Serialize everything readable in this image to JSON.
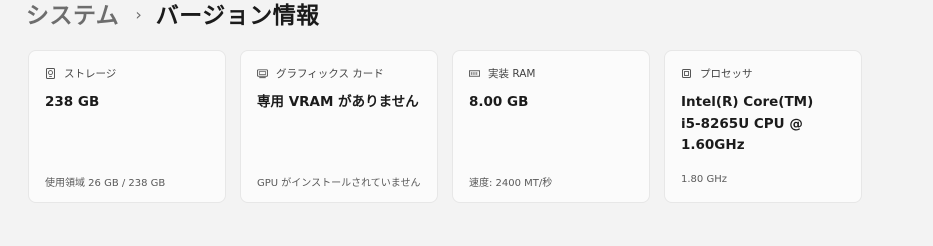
{
  "breadcrumb": {
    "parent": "システム",
    "separator": "›",
    "current": "バージョン情報"
  },
  "cards": [
    {
      "icon": "storage-icon",
      "title": "ストレージ",
      "value": "238 GB",
      "sub": "使用領域 26 GB / 238 GB"
    },
    {
      "icon": "graphics-card-icon",
      "title": "グラフィックス カード",
      "value": "専用 VRAM がありません",
      "sub": "GPU がインストールされていません"
    },
    {
      "icon": "memory-icon",
      "title": "実装 RAM",
      "value": "8.00 GB",
      "sub": "速度: 2400 MT/秒"
    },
    {
      "icon": "processor-icon",
      "title": "プロセッサ",
      "value": "Intel(R) Core(TM)\ni5-8265U CPU @\n1.60GHz",
      "sub": "1.80 GHz"
    }
  ]
}
